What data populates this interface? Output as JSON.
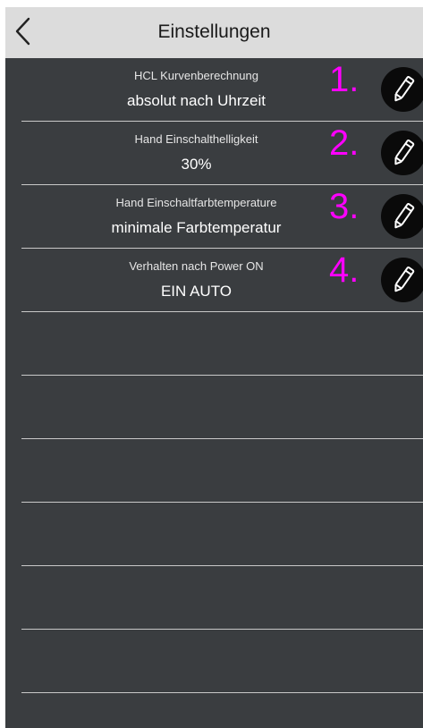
{
  "navbar": {
    "title": "Einstellungen",
    "back_icon": "chevron-left-icon"
  },
  "settings": [
    {
      "number": "1.",
      "label": "HCL Kurvenberechnung",
      "value": "absolut nach Uhrzeit"
    },
    {
      "number": "2.",
      "label": "Hand Einschalthelligkeit",
      "value": "30%"
    },
    {
      "number": "3.",
      "label": "Hand Einschaltfarbtemperature",
      "value": "minimale Farbtemperatur"
    },
    {
      "number": "4.",
      "label": "Verhalten nach Power ON",
      "value": "EIN AUTO"
    }
  ],
  "colors": {
    "background": "#3a3d40",
    "navbar": "#dcdcdc",
    "annotation_number": "#ff00ff",
    "edit_button": "#0a0a0a"
  },
  "icons": {
    "edit": "pencil-icon"
  }
}
